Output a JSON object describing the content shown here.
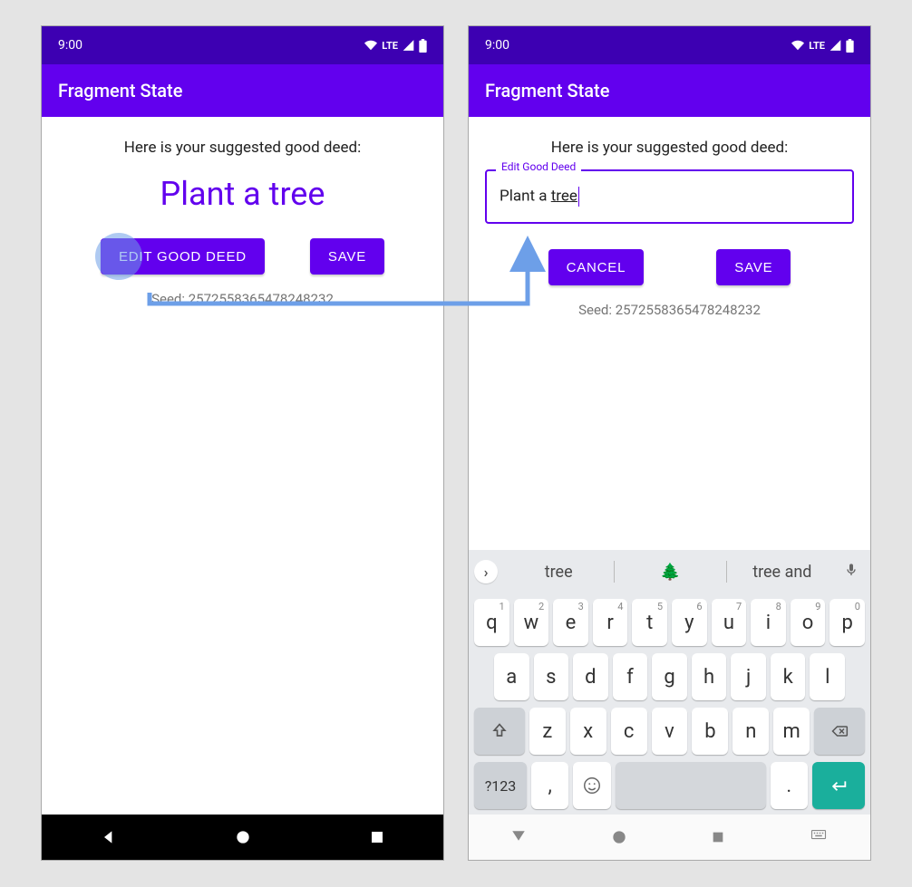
{
  "status": {
    "time": "9:00",
    "network": "LTE"
  },
  "app": {
    "title": "Fragment State"
  },
  "shared": {
    "prompt": "Here is your suggested good deed:",
    "seed_label": "Seed: 2572558365478248232"
  },
  "left": {
    "deed_text": "Plant a tree",
    "buttons": {
      "edit": "EDIT GOOD DEED",
      "save": "SAVE"
    }
  },
  "right": {
    "edit_label": "Edit Good Deed",
    "edit_value_prefix": "Plant a ",
    "edit_value_underlined": "tree",
    "buttons": {
      "cancel": "CANCEL",
      "save": "SAVE"
    }
  },
  "keyboard": {
    "suggestions": {
      "s1": "tree",
      "s2": "🌲",
      "s3": "tree and"
    },
    "row1": [
      {
        "k": "q",
        "sup": "1"
      },
      {
        "k": "w",
        "sup": "2"
      },
      {
        "k": "e",
        "sup": "3"
      },
      {
        "k": "r",
        "sup": "4"
      },
      {
        "k": "t",
        "sup": "5"
      },
      {
        "k": "y",
        "sup": "6"
      },
      {
        "k": "u",
        "sup": "7"
      },
      {
        "k": "i",
        "sup": "8"
      },
      {
        "k": "o",
        "sup": "9"
      },
      {
        "k": "p",
        "sup": "0"
      }
    ],
    "row2": [
      "a",
      "s",
      "d",
      "f",
      "g",
      "h",
      "j",
      "k",
      "l"
    ],
    "row3": [
      "z",
      "x",
      "c",
      "v",
      "b",
      "n",
      "m"
    ],
    "sym": "?123",
    "comma": ",",
    "period": "."
  }
}
